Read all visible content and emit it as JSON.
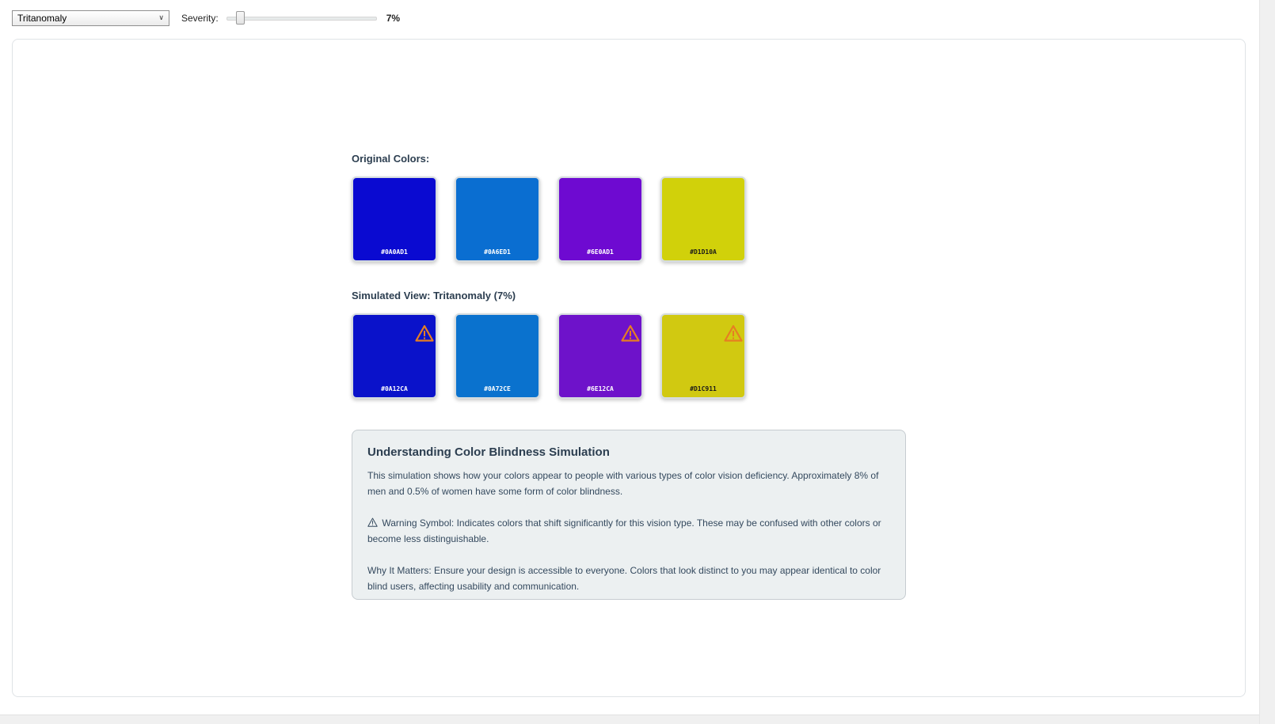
{
  "toolbar": {
    "vision_type": "Tritanomaly",
    "severity_label": "Severity:",
    "severity_value": "7%",
    "severity_fraction": 0.07
  },
  "original": {
    "label": "Original Colors:",
    "swatches": [
      {
        "hex": "#0A0AD1",
        "color": "#0A0AD1"
      },
      {
        "hex": "#0A6ED1",
        "color": "#0A6ED1"
      },
      {
        "hex": "#6E0AD1",
        "color": "#6E0AD1"
      },
      {
        "hex": "#D1D10A",
        "color": "#D1D10A"
      }
    ]
  },
  "simulated": {
    "label": "Simulated View: Tritanomaly (7%)",
    "swatches": [
      {
        "hex": "#0A12CA",
        "color": "#0A12CA",
        "warning": true
      },
      {
        "hex": "#0A72CE",
        "color": "#0A72CE",
        "warning": false
      },
      {
        "hex": "#6E12CA",
        "color": "#6E12CA",
        "warning": true
      },
      {
        "hex": "#D1C911",
        "color": "#D1C911",
        "warning": true
      }
    ]
  },
  "info": {
    "title": "Understanding Color Blindness Simulation",
    "p1": "This simulation shows how your colors appear to people with various types of color vision deficiency. Approximately 8% of men and 0.5% of women have some form of color blindness.",
    "p2": "Warning Symbol: Indicates colors that shift significantly for this vision type. These may be confused with other colors or become less distinguishable.",
    "p3": "Why It Matters: Ensure your design is accessible to everyone. Colors that look distinct to you may appear identical to color blind users, affecting usability and communication."
  },
  "colors": {
    "accent_warning": "#E67E22",
    "heading_text": "#2C3E50",
    "info_background": "#ECF0F1"
  },
  "icons": {
    "warning": "warning-icon",
    "dropdown": "chevron-down-icon"
  }
}
